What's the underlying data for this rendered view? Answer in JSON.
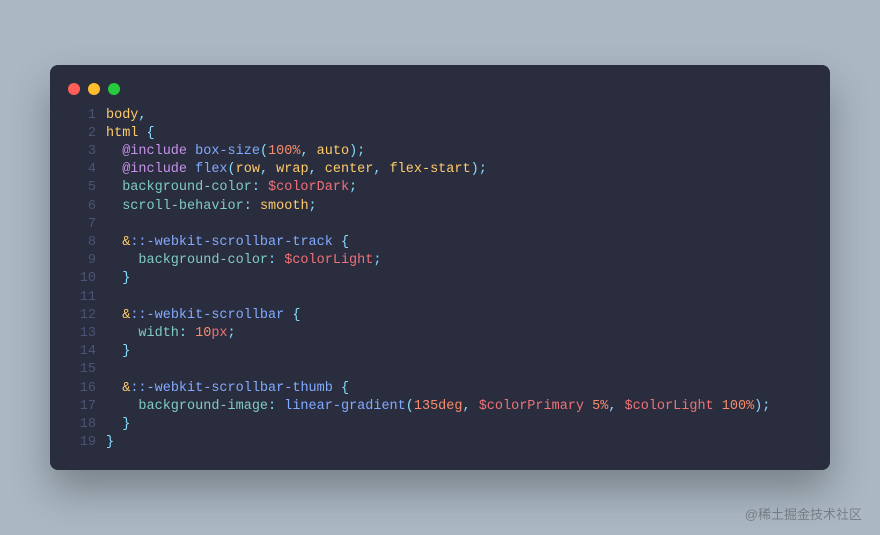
{
  "window": {
    "dots": [
      {
        "name": "close",
        "color": "#FF5F56"
      },
      {
        "name": "minimize",
        "color": "#FFBD2E"
      },
      {
        "name": "zoom",
        "color": "#27C93F"
      }
    ]
  },
  "watermark": "@稀土掘金技术社区",
  "syntax_palette": {
    "selector": "#FFCB6B",
    "atrule": "#C792EA",
    "func": "#82AAFF",
    "arg": "#F78C6C",
    "argAlt": "#FFCB6B",
    "prop": "#80CBC4",
    "ident": "#F07178",
    "value": "#FFCB6B",
    "punct": "#89DDFF",
    "plain": "#A6ACCD"
  },
  "code": [
    [
      {
        "t": "body",
        "c": "selector"
      },
      {
        "t": ",",
        "c": "punct"
      }
    ],
    [
      {
        "t": "html",
        "c": "selector"
      },
      {
        "t": " ",
        "c": "plain"
      },
      {
        "t": "{",
        "c": "punct"
      }
    ],
    [
      {
        "t": "  ",
        "c": "plain"
      },
      {
        "t": "@include",
        "c": "atrule"
      },
      {
        "t": " ",
        "c": "plain"
      },
      {
        "t": "box-size",
        "c": "func"
      },
      {
        "t": "(",
        "c": "punct"
      },
      {
        "t": "100%",
        "c": "arg"
      },
      {
        "t": ", ",
        "c": "punct"
      },
      {
        "t": "auto",
        "c": "argAlt"
      },
      {
        "t": ")",
        "c": "punct"
      },
      {
        "t": ";",
        "c": "punct"
      }
    ],
    [
      {
        "t": "  ",
        "c": "plain"
      },
      {
        "t": "@include",
        "c": "atrule"
      },
      {
        "t": " ",
        "c": "plain"
      },
      {
        "t": "flex",
        "c": "func"
      },
      {
        "t": "(",
        "c": "punct"
      },
      {
        "t": "row",
        "c": "argAlt"
      },
      {
        "t": ", ",
        "c": "punct"
      },
      {
        "t": "wrap",
        "c": "argAlt"
      },
      {
        "t": ", ",
        "c": "punct"
      },
      {
        "t": "center",
        "c": "argAlt"
      },
      {
        "t": ", ",
        "c": "punct"
      },
      {
        "t": "flex-start",
        "c": "argAlt"
      },
      {
        "t": ")",
        "c": "punct"
      },
      {
        "t": ";",
        "c": "punct"
      }
    ],
    [
      {
        "t": "  ",
        "c": "plain"
      },
      {
        "t": "background-color",
        "c": "prop"
      },
      {
        "t": ": ",
        "c": "punct"
      },
      {
        "t": "$colorDark",
        "c": "ident"
      },
      {
        "t": ";",
        "c": "punct"
      }
    ],
    [
      {
        "t": "  ",
        "c": "plain"
      },
      {
        "t": "scroll-behavior",
        "c": "prop"
      },
      {
        "t": ": ",
        "c": "punct"
      },
      {
        "t": "smooth",
        "c": "value"
      },
      {
        "t": ";",
        "c": "punct"
      }
    ],
    [],
    [
      {
        "t": "  ",
        "c": "plain"
      },
      {
        "t": "&",
        "c": "selector"
      },
      {
        "t": "::-webkit-scrollbar-track",
        "c": "func"
      },
      {
        "t": " ",
        "c": "plain"
      },
      {
        "t": "{",
        "c": "punct"
      }
    ],
    [
      {
        "t": "    ",
        "c": "plain"
      },
      {
        "t": "background-color",
        "c": "prop"
      },
      {
        "t": ": ",
        "c": "punct"
      },
      {
        "t": "$colorLight",
        "c": "ident"
      },
      {
        "t": ";",
        "c": "punct"
      }
    ],
    [
      {
        "t": "  ",
        "c": "plain"
      },
      {
        "t": "}",
        "c": "punct"
      }
    ],
    [],
    [
      {
        "t": "  ",
        "c": "plain"
      },
      {
        "t": "&",
        "c": "selector"
      },
      {
        "t": "::-webkit-scrollbar",
        "c": "func"
      },
      {
        "t": " ",
        "c": "plain"
      },
      {
        "t": "{",
        "c": "punct"
      }
    ],
    [
      {
        "t": "    ",
        "c": "plain"
      },
      {
        "t": "width",
        "c": "prop"
      },
      {
        "t": ": ",
        "c": "punct"
      },
      {
        "t": "10",
        "c": "arg"
      },
      {
        "t": "px",
        "c": "ident"
      },
      {
        "t": ";",
        "c": "punct"
      }
    ],
    [
      {
        "t": "  ",
        "c": "plain"
      },
      {
        "t": "}",
        "c": "punct"
      }
    ],
    [],
    [
      {
        "t": "  ",
        "c": "plain"
      },
      {
        "t": "&",
        "c": "selector"
      },
      {
        "t": "::-webkit-scrollbar-thumb",
        "c": "func"
      },
      {
        "t": " ",
        "c": "plain"
      },
      {
        "t": "{",
        "c": "punct"
      }
    ],
    [
      {
        "t": "    ",
        "c": "plain"
      },
      {
        "t": "background-image",
        "c": "prop"
      },
      {
        "t": ": ",
        "c": "punct"
      },
      {
        "t": "linear-gradient",
        "c": "func"
      },
      {
        "t": "(",
        "c": "punct"
      },
      {
        "t": "135deg",
        "c": "arg"
      },
      {
        "t": ", ",
        "c": "punct"
      },
      {
        "t": "$colorPrimary",
        "c": "ident"
      },
      {
        "t": " ",
        "c": "plain"
      },
      {
        "t": "5%",
        "c": "arg"
      },
      {
        "t": ", ",
        "c": "punct"
      },
      {
        "t": "$colorLight",
        "c": "ident"
      },
      {
        "t": " ",
        "c": "plain"
      },
      {
        "t": "100%",
        "c": "arg"
      },
      {
        "t": ")",
        "c": "punct"
      },
      {
        "t": ";",
        "c": "punct"
      }
    ],
    [
      {
        "t": "  ",
        "c": "plain"
      },
      {
        "t": "}",
        "c": "punct"
      }
    ],
    [
      {
        "t": "}",
        "c": "punct"
      }
    ]
  ]
}
